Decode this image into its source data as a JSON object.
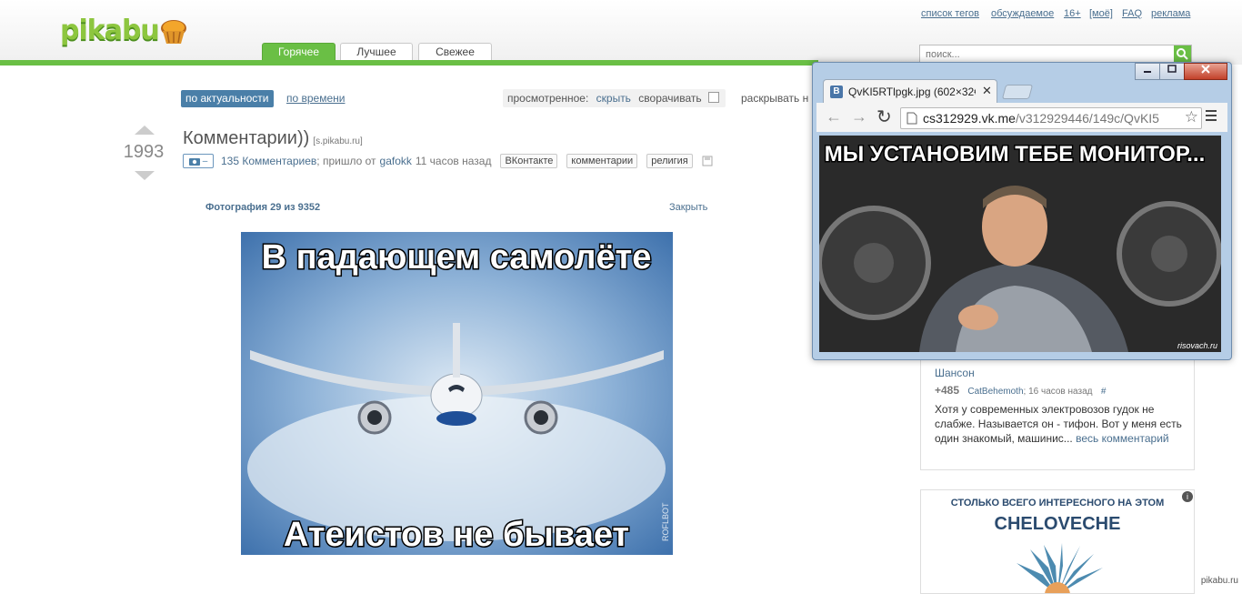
{
  "header": {
    "logo": "pikabu",
    "top_links": [
      "список тегов",
      "обсуждаемое",
      "16+",
      "[моё]",
      "FAQ",
      "реклама"
    ],
    "tabs": [
      {
        "label": "Горячее",
        "active": true
      },
      {
        "label": "Лучшее",
        "active": false
      },
      {
        "label": "Свежее",
        "active": false
      }
    ],
    "search_placeholder": "поиск..."
  },
  "sort": {
    "active": "по актуальности",
    "other": "по времени",
    "viewed_label": "просмотренное:",
    "hide_link": "скрыть",
    "collapse_label": "сворачивать",
    "expand_label": "раскрывать н"
  },
  "post": {
    "rating": "1993",
    "title": "Комментарии))",
    "source": "[s.pikabu.ru]",
    "photo_btn": "–",
    "comments_link": "135 Комментариев",
    "posted_text": "; пришло от",
    "author": "gafokk",
    "time_ago": "11 часов назад",
    "tags": [
      "ВКонтакте",
      "комментарии",
      "религия"
    ]
  },
  "photo_viewer": {
    "caption": "Фотография 29 из 9352",
    "close": "Закрыть",
    "image_top_text": "В падающем самолёте",
    "image_bottom_text": "Атеистов не бывает",
    "watermark": "ROFLBOT"
  },
  "popup": {
    "tab_title": "QvKI5RTlpgk.jpg (602×32€",
    "url_host": "cs312929.vk.me",
    "url_path": "/v312929446/149c/QvKI5",
    "image_text": "МЫ УСТАНОВИМ ТЕБЕ МОНИТОР...",
    "image_watermark": "risovach.ru"
  },
  "sidebar": {
    "link": "Шансон",
    "score": "+485",
    "user": "CatBehemoth",
    "time": "; 16 часов назад",
    "hash": "#",
    "comment": "Хотя у современных электровозов гудок не слабже. Называется он - тифон. Вот у меня есть один знакомый, машинис...",
    "more": "весь комментарий"
  },
  "ad": {
    "line1": "СТОЛЬКО ВСЕГО ИНТЕРЕСНОГО НА ЭТОМ",
    "line2": "CHELOVECHE"
  },
  "footer_watermark": "pikabu.ru",
  "colors": {
    "brand_green": "#6abf45",
    "link_blue": "#4a6f8f",
    "active_sort": "#4a7fa8"
  }
}
